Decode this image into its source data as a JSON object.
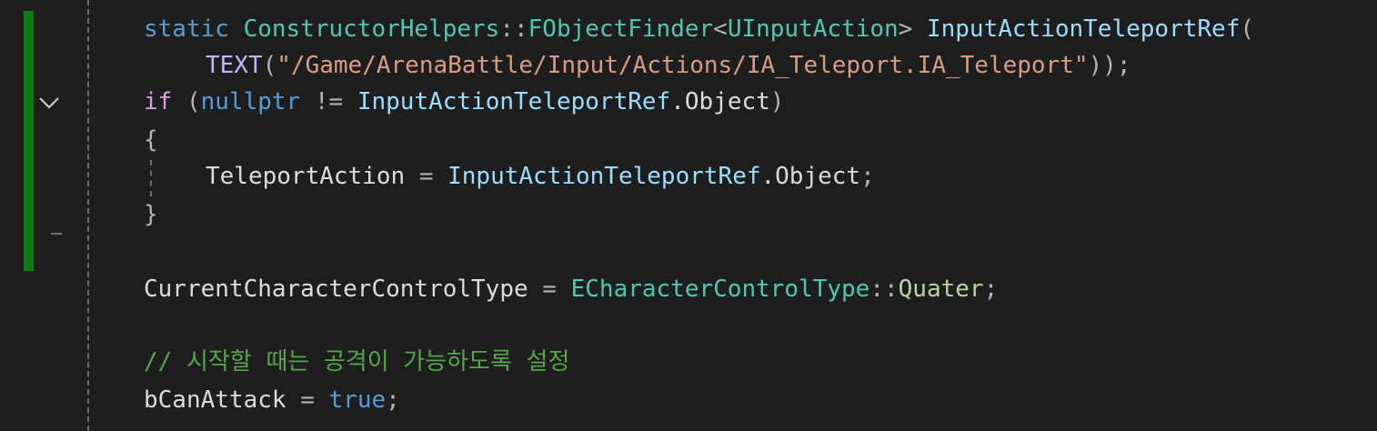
{
  "code": {
    "line1": {
      "kw_static": "static",
      "class_name": "ConstructorHelpers",
      "scope": "::",
      "finder": "FObjectFinder",
      "lt": "<",
      "tmpl_type": "UInputAction",
      "gt": ">",
      "var_name": "InputActionTeleportRef",
      "paren": "("
    },
    "line2": {
      "macro": "TEXT",
      "open": "(",
      "string": "\"/Game/ArenaBattle/Input/Actions/IA_Teleport.IA_Teleport\"",
      "close": "));"
    },
    "line3": {
      "kw_if": "if",
      "open": "(",
      "kw_nullptr": "nullptr",
      "op": "!=",
      "var": "InputActionTeleportRef",
      "member": ".Object",
      "close": ")"
    },
    "line4": {
      "brace": "{"
    },
    "line5": {
      "target": "TeleportAction",
      "op": "=",
      "var": "InputActionTeleportRef",
      "member": ".Object",
      "semi": ";"
    },
    "line6": {
      "brace": "}"
    },
    "line8": {
      "target": "CurrentCharacterControlType",
      "op": "=",
      "enum_type": "ECharacterControlType",
      "scope": "::",
      "enum_value": "Quater",
      "semi": ";"
    },
    "line10": {
      "comment": "// 시작할 때는 공격이 가능하도록 설정"
    },
    "line11": {
      "target": "bCanAttack",
      "op": "=",
      "kw_true": "true",
      "semi": ";"
    }
  },
  "gutter": {
    "fold_icon": "chevron-down-icon",
    "change_color": "#107c10"
  },
  "theme": {
    "background": "#1e1e1e",
    "keyword": "#569cd6",
    "control": "#d8a0df",
    "type": "#4ec9b0",
    "variable": "#9cdcfe",
    "string": "#d69d85",
    "comment": "#57a64a"
  }
}
